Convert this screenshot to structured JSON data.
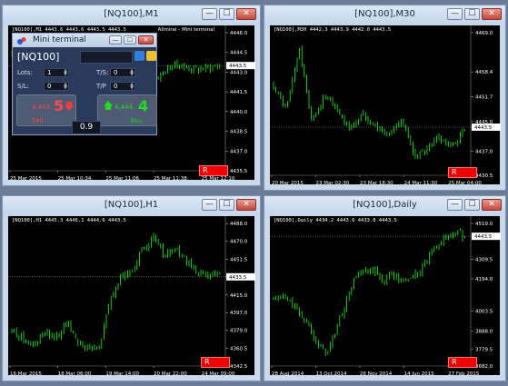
{
  "windows": [
    {
      "id": "w1",
      "title": "[NQ100],M1",
      "info": "[NQ100],M1  4443.6 4443.6 4443.5 4443.5",
      "info_right": "Alimiral - Mini terminal",
      "price_ticks": [
        "4446.0",
        "4444.5",
        "4443.0",
        "4441.5",
        "4440.0",
        "4438.5",
        "4437.0",
        "4435.5"
      ],
      "current_price": "4443.5",
      "time_ticks": [
        "25 Mar 2015",
        "25 Mar 10:34",
        "25 Mar 11:06",
        "25 Mar 11:38",
        "25 Mar 12:10"
      ],
      "button_label": "R",
      "chart_data": {
        "type": "candlestick",
        "instrument": "[NQ100]",
        "timeframe": "M1",
        "ylim": [
          4435.5,
          4446.0
        ],
        "series": [
          {
            "close": [
              4444.2,
              4444.6,
              4444.0,
              4444.8,
              4444.3,
              4443.5,
              4442.2,
              4443.6,
              4443.2,
              4443.5
            ]
          }
        ]
      }
    },
    {
      "id": "w2",
      "title": "[NQ100],M30",
      "info": "[NQ100],M30  4442.3 4443.9 4442.0 4443.5",
      "price_ticks": [
        "4469.0",
        "4458.4",
        "4451.7",
        "4445.0",
        "4443.5",
        "4437.0",
        "4430.5"
      ],
      "current_price": "4443.5",
      "time_ticks": [
        "20 Mar 2015",
        "23 Mar 02:30",
        "23 Mar 18:30",
        "24 Mar 11:30",
        "25 Mar 04:00"
      ],
      "button_label": "R",
      "chart_data": {
        "type": "candlestick",
        "instrument": "[NQ100]",
        "timeframe": "M30",
        "ylim": [
          4430.5,
          4469.0
        ],
        "series": [
          {
            "close": [
              4455,
              4448,
              4465,
              4445,
              4452,
              4448,
              4443,
              4447,
              4444,
              4441,
              4446,
              4436,
              4437,
              4441,
              4438,
              4443
            ]
          }
        ]
      }
    },
    {
      "id": "w3",
      "title": "[NQ100],H1",
      "info": "[NQ100],H1  4445.3 4446.1 4444.6 4443.5",
      "price_ticks": [
        "4488.0",
        "4470.0",
        "4451.5",
        "4433.5",
        "4415.0",
        "4397.0",
        "4379.0",
        "4360.5",
        "4342.5"
      ],
      "current_price": "4433.5",
      "time_ticks": [
        "16 Mar 2015",
        "18 Mar 06:00",
        "19 Mar 14:00",
        "20 Mar 22:00",
        "24 Mar 09:00"
      ],
      "button_label": "R",
      "chart_data": {
        "type": "candlestick",
        "instrument": "[NQ100]",
        "timeframe": "H1",
        "ylim": [
          4342.5,
          4488.0
        ],
        "series": [
          {
            "close": [
              4378,
              4372,
              4362,
              4376,
              4370,
              4388,
              4368,
              4360,
              4363,
              4410,
              4433,
              4440,
              4463,
              4472,
              4455,
              4462,
              4448,
              4436,
              4438,
              4433
            ]
          }
        ]
      }
    },
    {
      "id": "w4",
      "title": "[NQ100],Daily",
      "info": "[NQ100],Daily  4434.2 4443.6 4433.8 4443.5",
      "price_ticks": [
        "4519.0",
        "4443.5",
        "4309.5",
        "4194.0",
        "4003.5",
        "3888.0",
        "3779.5",
        "3682.0"
      ],
      "current_price": "4443.5",
      "time_ticks": [
        "28 Aug 2014",
        "13 Oct 2014",
        "26 Nov 2014",
        "14 Jun 2015",
        "27 Feb 2015"
      ],
      "button_label": "R",
      "chart_data": {
        "type": "candlestick",
        "instrument": "[NQ100]",
        "timeframe": "Daily",
        "ylim": [
          3682.0,
          4519.0
        ],
        "series": [
          {
            "close": [
              4070,
              4090,
              4050,
              3980,
              3920,
              3790,
              3760,
              3920,
              4060,
              4210,
              4230,
              4240,
              4180,
              4230,
              4170,
              4200,
              4230,
              4310,
              4400,
              4440,
              4470,
              4443
            ]
          }
        ]
      }
    }
  ],
  "mini_terminal": {
    "title": "Mini terminal",
    "symbol": "[NQ100]",
    "lots_label": "Lots:",
    "lots_value": "1",
    "ts_label": "T/S:",
    "ts_value": "0",
    "sl_label": "S/L:",
    "sl_value": "0",
    "tp_label": "T/P",
    "tp_value": "0",
    "sell_price_small": "4,443.",
    "sell_price_big": "5",
    "buy_price_small": "4,444.",
    "buy_price_big": "4",
    "sell_label": "Sell",
    "buy_label": "Buy",
    "volume": "0.9"
  },
  "colors": {
    "candle": "#00ff00",
    "grid": "#3a3a3a",
    "sell": "#ff3c3c",
    "buy": "#22dd22",
    "background": "#000000"
  }
}
